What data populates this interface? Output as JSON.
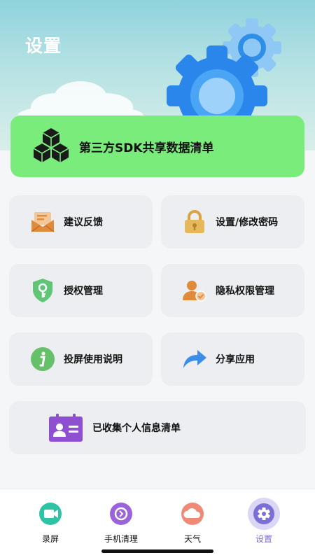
{
  "header": {
    "title": "设置"
  },
  "sdk_card": {
    "label": "第三方SDK共享数据清单",
    "icon": "cubes-icon"
  },
  "tiles": [
    {
      "label": "建议反馈",
      "icon": "mail-icon",
      "color": "#e08b3c"
    },
    {
      "label": "设置/修改密码",
      "icon": "lock-icon",
      "color": "#e6b85c"
    },
    {
      "label": "授权管理",
      "icon": "shield-key-icon",
      "color": "#5fc676"
    },
    {
      "label": "隐私权限管理",
      "icon": "user-check-icon",
      "color": "#e08b3c"
    },
    {
      "label": "投屏使用说明",
      "icon": "info-icon",
      "color": "#66c06a"
    },
    {
      "label": "分享应用",
      "icon": "share-icon",
      "color": "#3a8ee8"
    },
    {
      "label": "已收集个人信息清单",
      "icon": "id-card-icon",
      "color": "#8e4fd0"
    }
  ],
  "tabbar": {
    "items": [
      {
        "label": "录屏",
        "icon": "video-icon",
        "color": "#2ec3a5",
        "active": false
      },
      {
        "label": "手机清理",
        "icon": "clean-icon",
        "color": "#9a63dc",
        "active": false
      },
      {
        "label": "天气",
        "icon": "cloud-icon",
        "color": "#ef8a78",
        "active": false
      },
      {
        "label": "设置",
        "icon": "gear-icon",
        "color": "#7a6fd6",
        "active": true
      }
    ]
  }
}
